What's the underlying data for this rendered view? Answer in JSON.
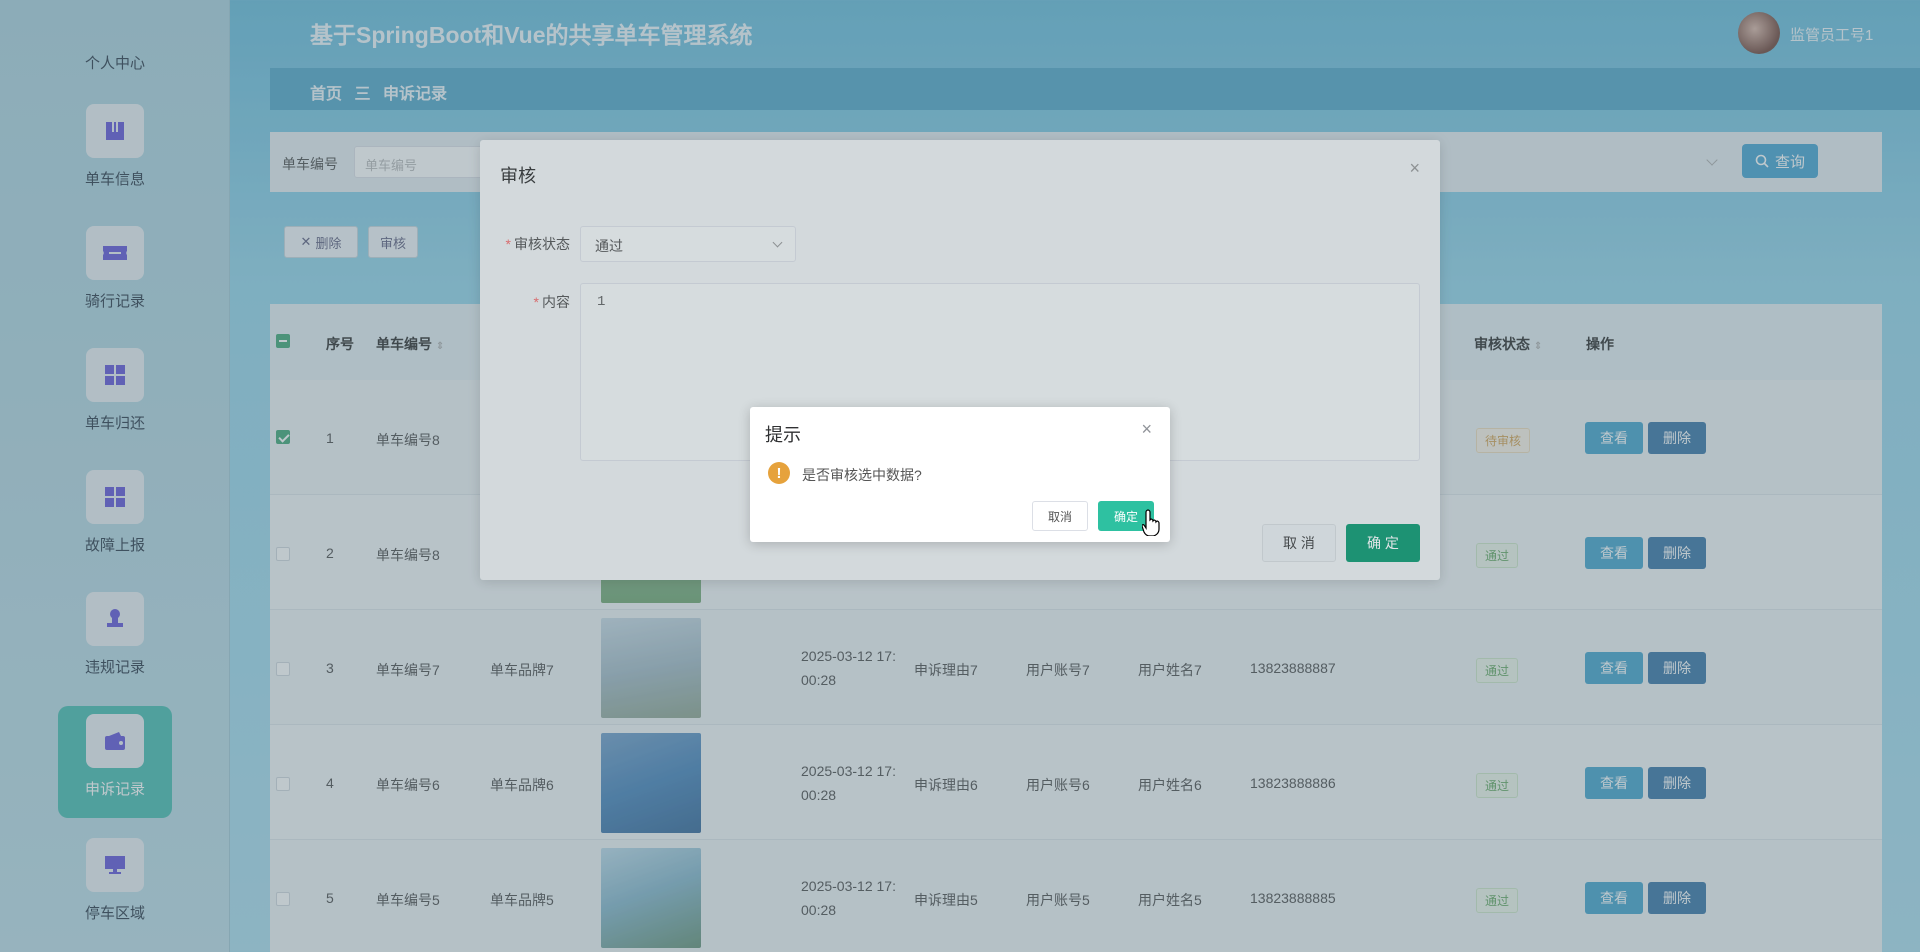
{
  "header": {
    "title": "基于SpringBoot和Vue的共享单车管理系统",
    "user_name": "监管员工号1"
  },
  "breadcrumb": {
    "home": "首页",
    "separator": "三",
    "current": "申诉记录"
  },
  "sidebar": {
    "items": [
      {
        "label": "个人中心",
        "icon": "user-icon"
      },
      {
        "label": "单车信息",
        "icon": "bike-info-icon"
      },
      {
        "label": "骑行记录",
        "icon": "ride-record-icon"
      },
      {
        "label": "单车归还",
        "icon": "grid-icon"
      },
      {
        "label": "故障上报",
        "icon": "grid-icon"
      },
      {
        "label": "违规记录",
        "icon": "stamp-icon"
      },
      {
        "label": "申诉记录",
        "icon": "wallet-icon",
        "active": true
      },
      {
        "label": "停车区域",
        "icon": "monitor-icon"
      }
    ]
  },
  "search": {
    "label": "单车编号",
    "placeholder": "单车编号",
    "button": "查询"
  },
  "actions": {
    "delete": "删除",
    "audit": "审核"
  },
  "table": {
    "headers": {
      "index": "序号",
      "bike_no": "单车编号",
      "audit_status": "审核状态",
      "actions": "操作"
    },
    "rows": [
      {
        "index": "1",
        "bike_no": "单车编号8",
        "brand": "",
        "time_line1": "",
        "time_line2": "",
        "reason": "",
        "account": "",
        "name": "",
        "phone": "",
        "status": "待审核",
        "checked": true
      },
      {
        "index": "2",
        "bike_no": "单车编号8",
        "brand": "",
        "time_line1": "",
        "time_line2": "",
        "reason": "",
        "account": "",
        "name": "",
        "phone": "",
        "status": "通过",
        "checked": false
      },
      {
        "index": "3",
        "bike_no": "单车编号7",
        "brand": "单车品牌7",
        "time_line1": "2025-03-12 17:",
        "time_line2": "00:28",
        "reason": "申诉理由7",
        "account": "用户账号7",
        "name": "用户姓名7",
        "phone": "13823888887",
        "status": "通过",
        "checked": false
      },
      {
        "index": "4",
        "bike_no": "单车编号6",
        "brand": "单车品牌6",
        "time_line1": "2025-03-12 17:",
        "time_line2": "00:28",
        "reason": "申诉理由6",
        "account": "用户账号6",
        "name": "用户姓名6",
        "phone": "13823888886",
        "status": "通过",
        "checked": false
      },
      {
        "index": "5",
        "bike_no": "单车编号5",
        "brand": "单车品牌5",
        "time_line1": "2025-03-12 17:",
        "time_line2": "00:28",
        "reason": "申诉理由5",
        "account": "用户账号5",
        "name": "用户姓名5",
        "phone": "13823888885",
        "status": "通过",
        "checked": false
      }
    ],
    "view_label": "查看",
    "delete_label": "删除"
  },
  "audit_dialog": {
    "title": "审核",
    "status_label": "审核状态",
    "status_value": "通过",
    "content_label": "内容",
    "content_value": "1",
    "cancel": "取 消",
    "ok": "确 定"
  },
  "confirm_dialog": {
    "title": "提示",
    "message": "是否审核选中数据?",
    "cancel": "取消",
    "ok": "确定"
  },
  "colors": {
    "primary": "#3aa0cb",
    "success": "#109a72",
    "warning": "#e6a23c",
    "confirm_ok": "#2ec1a1"
  }
}
